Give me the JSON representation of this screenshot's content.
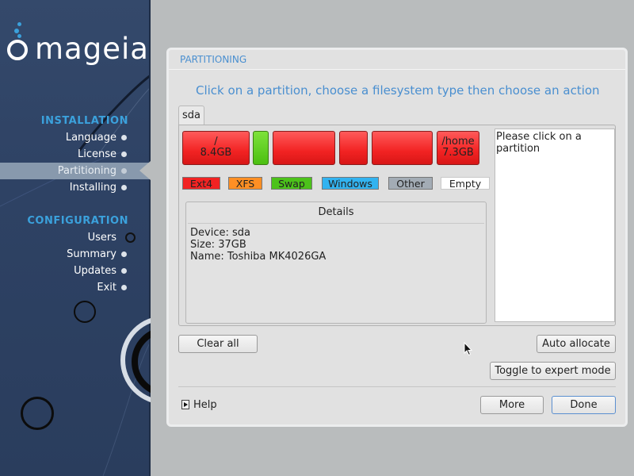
{
  "brand": {
    "name": "mageia",
    "accent_color": "#3ba1dc"
  },
  "sidebar": {
    "sections": [
      {
        "title": "INSTALLATION",
        "items": [
          {
            "label": "Language",
            "state": "done"
          },
          {
            "label": "License",
            "state": "done"
          },
          {
            "label": "Partitioning",
            "state": "current"
          },
          {
            "label": "Installing",
            "state": "pending"
          }
        ]
      },
      {
        "title": "CONFIGURATION",
        "items": [
          {
            "label": "Users",
            "state": "pending"
          },
          {
            "label": "Summary",
            "state": "pending"
          },
          {
            "label": "Updates",
            "state": "pending"
          },
          {
            "label": "Exit",
            "state": "pending"
          }
        ]
      }
    ]
  },
  "panel": {
    "title": "PARTITIONING",
    "instruction": "Click on a partition, choose a filesystem type then choose an action",
    "tabs": [
      {
        "label": "sda"
      }
    ],
    "partitions": [
      {
        "mount": "/",
        "size": "8.4GB",
        "type": "Ext4",
        "color": "#f22323"
      },
      {
        "mount": "",
        "size": "",
        "type": "Swap",
        "color": "#4cbf12"
      },
      {
        "mount": "",
        "size": "",
        "type": "Ext4",
        "color": "#f22323"
      },
      {
        "mount": "",
        "size": "",
        "type": "Ext4",
        "color": "#f22323"
      },
      {
        "mount": "",
        "size": "",
        "type": "Ext4",
        "color": "#f22323"
      },
      {
        "mount": "/home",
        "size": "7.3GB",
        "type": "Ext4",
        "color": "#f22323"
      }
    ],
    "legend": [
      {
        "label": "Ext4",
        "color": "#f22323"
      },
      {
        "label": "XFS",
        "color": "#ff8f24"
      },
      {
        "label": "Swap",
        "color": "#4cc21a"
      },
      {
        "label": "Windows",
        "color": "#32b3f0"
      },
      {
        "label": "Other",
        "color": "#a3acb5"
      },
      {
        "label": "Empty",
        "color": "#ffffff"
      }
    ],
    "details": {
      "title": "Details",
      "device": "Device: sda",
      "size": "Size: 37GB",
      "name": "Name: Toshiba MK4026GA"
    },
    "info_text": "Please click on a partition",
    "buttons": {
      "clear_all": "Clear all",
      "auto_allocate": "Auto allocate",
      "toggle_expert": "Toggle to expert mode",
      "help": "Help",
      "more": "More",
      "done": "Done"
    }
  }
}
